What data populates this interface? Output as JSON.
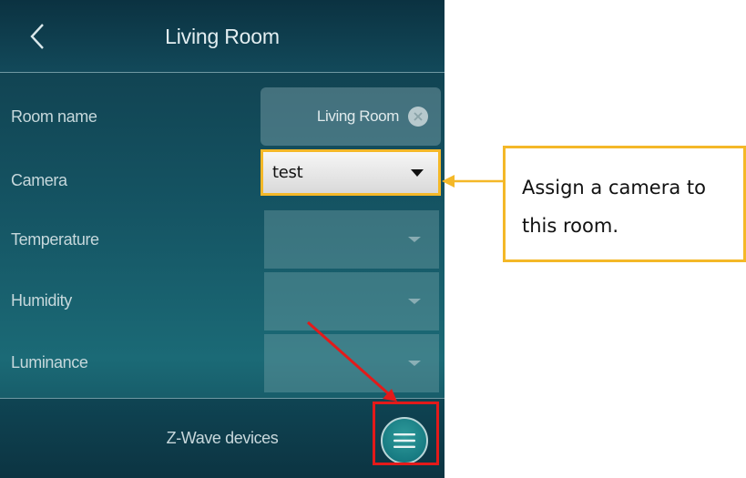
{
  "header": {
    "title": "Living Room",
    "back_icon": "chevron-left-icon"
  },
  "form": {
    "room_name": {
      "label": "Room name",
      "value": "Living Room",
      "clear_icon": "clear-icon"
    },
    "camera": {
      "label": "Camera",
      "value": "test"
    },
    "temperature": {
      "label": "Temperature",
      "value": ""
    },
    "humidity": {
      "label": "Humidity",
      "value": ""
    },
    "luminance": {
      "label": "Luminance",
      "value": ""
    }
  },
  "footer": {
    "label": "Z-Wave devices",
    "menu_icon": "hamburger-menu-icon"
  },
  "annotation": {
    "callout_text": "Assign a camera to this room.",
    "callout_color": "#f4b828",
    "highlight_color": "#e31a1a"
  }
}
